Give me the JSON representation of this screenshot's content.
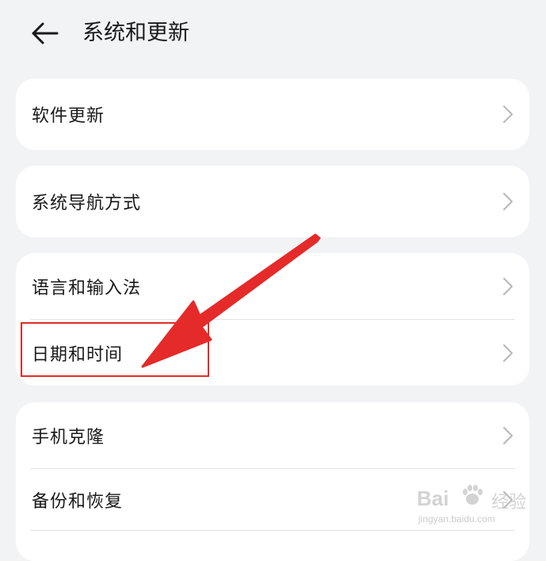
{
  "header": {
    "title": "系统和更新",
    "back_icon": "arrow-left-icon"
  },
  "cards": [
    {
      "items": [
        {
          "label": "软件更新"
        }
      ]
    },
    {
      "items": [
        {
          "label": "系统导航方式"
        }
      ]
    },
    {
      "items": [
        {
          "label": "语言和输入法"
        },
        {
          "label": "日期和时间"
        }
      ]
    },
    {
      "items": [
        {
          "label": "手机克隆"
        },
        {
          "label": "备份和恢复"
        }
      ]
    }
  ],
  "annotation": {
    "color": "#e52a2a",
    "target": "日期和时间"
  },
  "watermark": {
    "brand_left": "Bai",
    "brand_right": "经验",
    "url": "jingyan.baidu.com"
  },
  "colors": {
    "background": "#f1f3f5",
    "card": "#ffffff",
    "accent": "#e52a2a",
    "chevron": "#b8b8b8"
  }
}
